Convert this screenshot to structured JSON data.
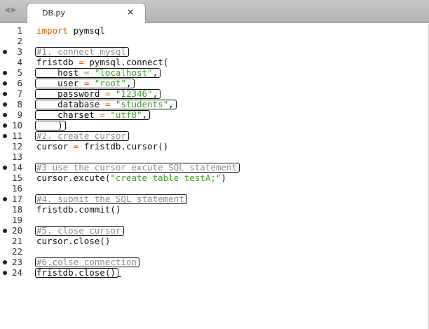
{
  "tab": {
    "title": "DB.py",
    "close_glyph": "×",
    "back_glyph": "◀",
    "forward_glyph": "▶"
  },
  "lines": [
    {
      "n": "1",
      "mark": false,
      "segs": [
        [
          "kw",
          "import"
        ],
        [
          "",
          " pymsql"
        ]
      ]
    },
    {
      "n": "2",
      "mark": false,
      "segs": []
    },
    {
      "n": "3",
      "mark": true,
      "segs": [
        [
          "cmt",
          "#1. connect mysql"
        ]
      ]
    },
    {
      "n": "4",
      "mark": false,
      "segs": [
        [
          "",
          "fristdb "
        ],
        [
          "kw",
          "="
        ],
        [
          "",
          " pymsql.connect("
        ]
      ]
    },
    {
      "n": "5",
      "mark": true,
      "segs": [
        [
          "",
          "    host "
        ],
        [
          "kw",
          "="
        ],
        [
          "",
          " "
        ],
        [
          "str",
          "\"localhost\""
        ],
        [
          "",
          ","
        ]
      ]
    },
    {
      "n": "6",
      "mark": true,
      "segs": [
        [
          "",
          "    user "
        ],
        [
          "kw",
          "="
        ],
        [
          "",
          " "
        ],
        [
          "str",
          "\"root\""
        ],
        [
          "",
          ","
        ]
      ]
    },
    {
      "n": "7",
      "mark": true,
      "segs": [
        [
          "",
          "    password "
        ],
        [
          "kw",
          "="
        ],
        [
          "",
          " "
        ],
        [
          "str",
          "\"12346\""
        ],
        [
          "",
          ","
        ]
      ]
    },
    {
      "n": "8",
      "mark": true,
      "segs": [
        [
          "",
          "    database "
        ],
        [
          "kw",
          "="
        ],
        [
          "",
          " "
        ],
        [
          "str",
          "\"students\""
        ],
        [
          "",
          ","
        ]
      ]
    },
    {
      "n": "9",
      "mark": true,
      "segs": [
        [
          "",
          "    charset "
        ],
        [
          "kw",
          "="
        ],
        [
          "",
          " "
        ],
        [
          "str",
          "\"utf8\""
        ],
        [
          "",
          ","
        ]
      ]
    },
    {
      "n": "10",
      "mark": true,
      "segs": [
        [
          "",
          "    )"
        ]
      ]
    },
    {
      "n": "11",
      "mark": true,
      "segs": [
        [
          "cmt",
          "#2. create cursor"
        ]
      ]
    },
    {
      "n": "12",
      "mark": false,
      "segs": [
        [
          "",
          "cursor "
        ],
        [
          "kw",
          "="
        ],
        [
          "",
          " fristdb.cursor()"
        ]
      ]
    },
    {
      "n": "13",
      "mark": false,
      "segs": []
    },
    {
      "n": "14",
      "mark": true,
      "segs": [
        [
          "cmt",
          "#3 use the cursor excute SQL statement"
        ]
      ]
    },
    {
      "n": "15",
      "mark": false,
      "segs": [
        [
          "",
          "cursor.excute("
        ],
        [
          "str",
          "\"create table testA;\""
        ],
        [
          "",
          ")"
        ]
      ]
    },
    {
      "n": "16",
      "mark": false,
      "segs": []
    },
    {
      "n": "17",
      "mark": true,
      "segs": [
        [
          "cmt",
          "#4. submit the SQL statement"
        ]
      ]
    },
    {
      "n": "18",
      "mark": false,
      "segs": [
        [
          "",
          "fristdb.commit()"
        ]
      ]
    },
    {
      "n": "19",
      "mark": false,
      "segs": []
    },
    {
      "n": "20",
      "mark": true,
      "segs": [
        [
          "cmt",
          "#5. close cursor"
        ]
      ]
    },
    {
      "n": "21",
      "mark": false,
      "segs": [
        [
          "",
          "cursor.close()"
        ]
      ]
    },
    {
      "n": "22",
      "mark": false,
      "segs": []
    },
    {
      "n": "23",
      "mark": true,
      "segs": [
        [
          "cmt",
          "#6.colse connection"
        ]
      ]
    },
    {
      "n": "24",
      "mark": true,
      "segs": [
        [
          "",
          "fristdb.close()"
        ]
      ]
    }
  ]
}
